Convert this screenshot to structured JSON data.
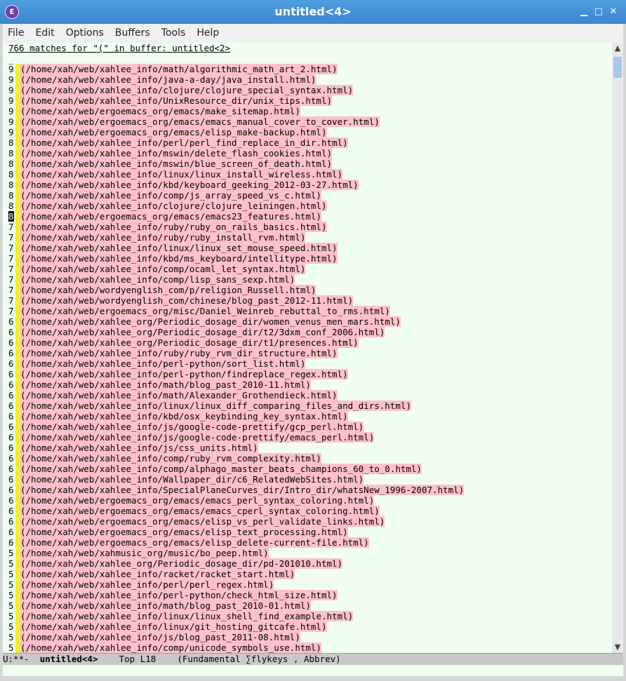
{
  "window": {
    "title": "untitled<4>",
    "icon": "emacs-icon",
    "controls": {
      "minimize": "▁",
      "maximize": "□",
      "close": "✕"
    }
  },
  "menu": [
    "File",
    "Edit",
    "Options",
    "Buffers",
    "Tools",
    "Help"
  ],
  "buffer": {
    "header": "766 matches for \"(\" in buffer: untitled<2>",
    "cursor_char": "_",
    "active_row": 14,
    "rows": [
      {
        "count": "9",
        "path": "(/home/xah/web/xahlee_info/math/algorithmic_math_art_2.html)"
      },
      {
        "count": "9",
        "path": "(/home/xah/web/xahlee_info/java-a-day/java_install.html)"
      },
      {
        "count": "9",
        "path": "(/home/xah/web/xahlee_info/clojure/clojure_special_syntax.html)"
      },
      {
        "count": "9",
        "path": "(/home/xah/web/xahlee_info/UnixResource_dir/unix_tips.html)"
      },
      {
        "count": "9",
        "path": "(/home/xah/web/ergoemacs_org/emacs/make_sitemap.html)"
      },
      {
        "count": "9",
        "path": "(/home/xah/web/ergoemacs_org/emacs/emacs_manual_cover_to_cover.html)"
      },
      {
        "count": "9",
        "path": "(/home/xah/web/ergoemacs_org/emacs/elisp_make-backup.html)"
      },
      {
        "count": "8",
        "path": "(/home/xah/web/xahlee_info/perl/perl_find_replace_in_dir.html)"
      },
      {
        "count": "8",
        "path": "(/home/xah/web/xahlee_info/mswin/delete_flash_cookies.html)"
      },
      {
        "count": "8",
        "path": "(/home/xah/web/xahlee_info/mswin/blue_screen_of_death.html)"
      },
      {
        "count": "8",
        "path": "(/home/xah/web/xahlee_info/linux/linux_install_wireless.html)"
      },
      {
        "count": "8",
        "path": "(/home/xah/web/xahlee_info/kbd/keyboard_geeking_2012-03-27.html)"
      },
      {
        "count": "8",
        "path": "(/home/xah/web/xahlee_info/comp/js_array_speed_vs_c.html)"
      },
      {
        "count": "8",
        "path": "(/home/xah/web/xahlee_info/clojure/clojure_leiningen.html)"
      },
      {
        "count": "8",
        "path": "(/home/xah/web/ergoemacs_org/emacs/emacs23_features.html)"
      },
      {
        "count": "7",
        "path": "(/home/xah/web/xahlee_info/ruby/ruby_on_rails_basics.html)"
      },
      {
        "count": "7",
        "path": "(/home/xah/web/xahlee_info/ruby/ruby_install_rvm.html)"
      },
      {
        "count": "7",
        "path": "(/home/xah/web/xahlee_info/linux/linux_set_mouse_speed.html)"
      },
      {
        "count": "7",
        "path": "(/home/xah/web/xahlee_info/kbd/ms_keyboard/intellitype.html)"
      },
      {
        "count": "7",
        "path": "(/home/xah/web/xahlee_info/comp/ocaml_let_syntax.html)"
      },
      {
        "count": "7",
        "path": "(/home/xah/web/xahlee_info/comp/lisp_sans_sexp.html)"
      },
      {
        "count": "7",
        "path": "(/home/xah/web/wordyenglish_com/p/religion_Russell.html)"
      },
      {
        "count": "7",
        "path": "(/home/xah/web/wordyenglish_com/chinese/blog_past_2012-11.html)"
      },
      {
        "count": "7",
        "path": "(/home/xah/web/ergoemacs_org/misc/Daniel_Weinreb_rebuttal_to_rms.html)"
      },
      {
        "count": "6",
        "path": "(/home/xah/web/xahlee_org/Periodic_dosage_dir/women_venus_men_mars.html)"
      },
      {
        "count": "6",
        "path": "(/home/xah/web/xahlee_org/Periodic_dosage_dir/t2/3dxm_conf_2006.html)"
      },
      {
        "count": "6",
        "path": "(/home/xah/web/xahlee_org/Periodic_dosage_dir/t1/presences.html)"
      },
      {
        "count": "6",
        "path": "(/home/xah/web/xahlee_info/ruby/ruby_rvm_dir_structure.html)"
      },
      {
        "count": "6",
        "path": "(/home/xah/web/xahlee_info/perl-python/sort_list.html)"
      },
      {
        "count": "6",
        "path": "(/home/xah/web/xahlee_info/perl-python/findreplace_regex.html)"
      },
      {
        "count": "6",
        "path": "(/home/xah/web/xahlee_info/math/blog_past_2010-11.html)"
      },
      {
        "count": "6",
        "path": "(/home/xah/web/xahlee_info/math/Alexander_Grothendieck.html)"
      },
      {
        "count": "6",
        "path": "(/home/xah/web/xahlee_info/linux/linux_diff_comparing_files_and_dirs.html)"
      },
      {
        "count": "6",
        "path": "(/home/xah/web/xahlee_info/kbd/osx_keybinding_key_syntax.html)"
      },
      {
        "count": "6",
        "path": "(/home/xah/web/xahlee_info/js/google-code-prettify/gcp_perl.html)"
      },
      {
        "count": "6",
        "path": "(/home/xah/web/xahlee_info/js/google-code-prettify/emacs_perl.html)"
      },
      {
        "count": "6",
        "path": "(/home/xah/web/xahlee_info/js/css_units.html)"
      },
      {
        "count": "6",
        "path": "(/home/xah/web/xahlee_info/comp/ruby_rvm_complexity.html)"
      },
      {
        "count": "6",
        "path": "(/home/xah/web/xahlee_info/comp/alphago_master_beats_champions_60_to_0.html)"
      },
      {
        "count": "6",
        "path": "(/home/xah/web/xahlee_info/Wallpaper_dir/c6_RelatedWebSites.html)"
      },
      {
        "count": "6",
        "path": "(/home/xah/web/xahlee_info/SpecialPlaneCurves_dir/Intro_dir/whatsNew_1996-2007.html)"
      },
      {
        "count": "6",
        "path": "(/home/xah/web/ergoemacs_org/emacs/emacs_perl_syntax_coloring.html)"
      },
      {
        "count": "6",
        "path": "(/home/xah/web/ergoemacs_org/emacs/emacs_cperl_syntax_coloring.html)"
      },
      {
        "count": "6",
        "path": "(/home/xah/web/ergoemacs_org/emacs/elisp_vs_perl_validate_links.html)"
      },
      {
        "count": "6",
        "path": "(/home/xah/web/ergoemacs_org/emacs/elisp_text_processing.html)"
      },
      {
        "count": "6",
        "path": "(/home/xah/web/ergoemacs_org/emacs/elisp_delete-current-file.html)"
      },
      {
        "count": "5",
        "path": "(/home/xah/web/xahmusic_org/music/bo_peep.html)"
      },
      {
        "count": "5",
        "path": "(/home/xah/web/xahlee_org/Periodic_dosage_dir/pd-201010.html)"
      },
      {
        "count": "5",
        "path": "(/home/xah/web/xahlee_info/racket/racket_start.html)"
      },
      {
        "count": "5",
        "path": "(/home/xah/web/xahlee_info/perl/perl_regex.html)"
      },
      {
        "count": "5",
        "path": "(/home/xah/web/xahlee_info/perl-python/check_html_size.html)"
      },
      {
        "count": "5",
        "path": "(/home/xah/web/xahlee_info/math/blog_past_2010-01.html)"
      },
      {
        "count": "5",
        "path": "(/home/xah/web/xahlee_info/linux/linux_shell_find_example.html)"
      },
      {
        "count": "5",
        "path": "(/home/xah/web/xahlee_info/linux/git_hosting_gitcafe.html)"
      },
      {
        "count": "5",
        "path": "(/home/xah/web/xahlee_info/js/blog_past_2011-08.html)"
      },
      {
        "count": "5",
        "path": "(/home/xah/web/xahlee_info/comp/unicode_symbols_use.html)"
      }
    ]
  },
  "modeline": {
    "prefix": "U:**-  ",
    "buffer_name": "untitled<4>",
    "position": "    Top L18    ",
    "modes": "(Fundamental ∑flykeys , Abbrev)"
  },
  "scrollbar": {
    "up": "▲",
    "down": "▼"
  }
}
